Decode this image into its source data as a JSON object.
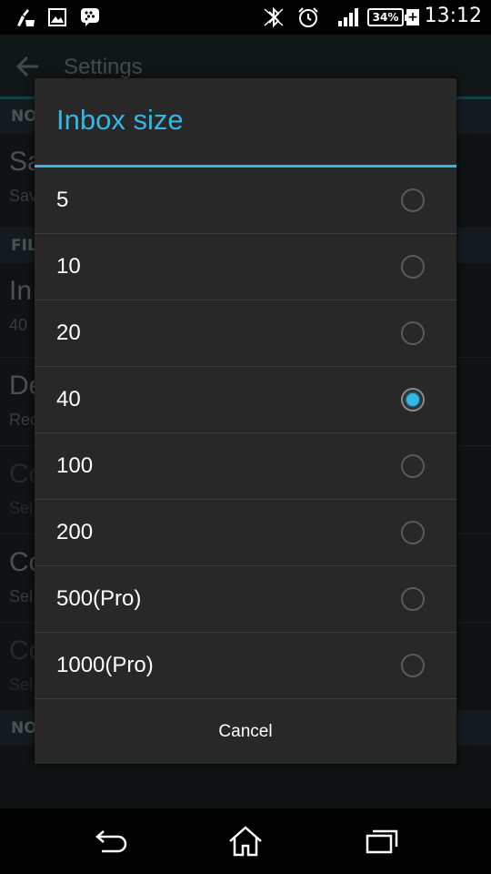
{
  "status_bar": {
    "time": "13:12",
    "battery_percent": "34%",
    "icons": [
      "cleaner-icon",
      "image-icon",
      "bbm-icon",
      "bluetooth-off-icon",
      "alarm-icon",
      "signal-icon",
      "battery-icon",
      "charging-icon"
    ]
  },
  "background": {
    "title": "Settings",
    "section_headers": [
      "NO",
      "FIL",
      "NO"
    ],
    "rows": [
      {
        "title": "Sa",
        "subtitle": "Sav"
      },
      {
        "title": "In",
        "subtitle": "40"
      },
      {
        "title": "De",
        "subtitle": "Rec"
      },
      {
        "title": "Co",
        "subtitle": "Sel"
      },
      {
        "title": "Co",
        "subtitle": "Sel"
      },
      {
        "title": "Co",
        "subtitle": "Sel"
      }
    ]
  },
  "dialog": {
    "title": "Inbox size",
    "options": [
      {
        "label": "5",
        "checked": false
      },
      {
        "label": "10",
        "checked": false
      },
      {
        "label": "20",
        "checked": false
      },
      {
        "label": "40",
        "checked": true
      },
      {
        "label": "100",
        "checked": false
      },
      {
        "label": "200",
        "checked": false
      },
      {
        "label": "500(Pro)",
        "checked": false
      },
      {
        "label": "1000(Pro)",
        "checked": false
      }
    ],
    "cancel_label": "Cancel"
  },
  "colors": {
    "accent": "#33b5e5",
    "dialog_bg": "#282828",
    "screen_bg": "#1c2326"
  },
  "nav_bar": {
    "icons": [
      "back-icon",
      "home-icon",
      "recent-apps-icon"
    ]
  }
}
